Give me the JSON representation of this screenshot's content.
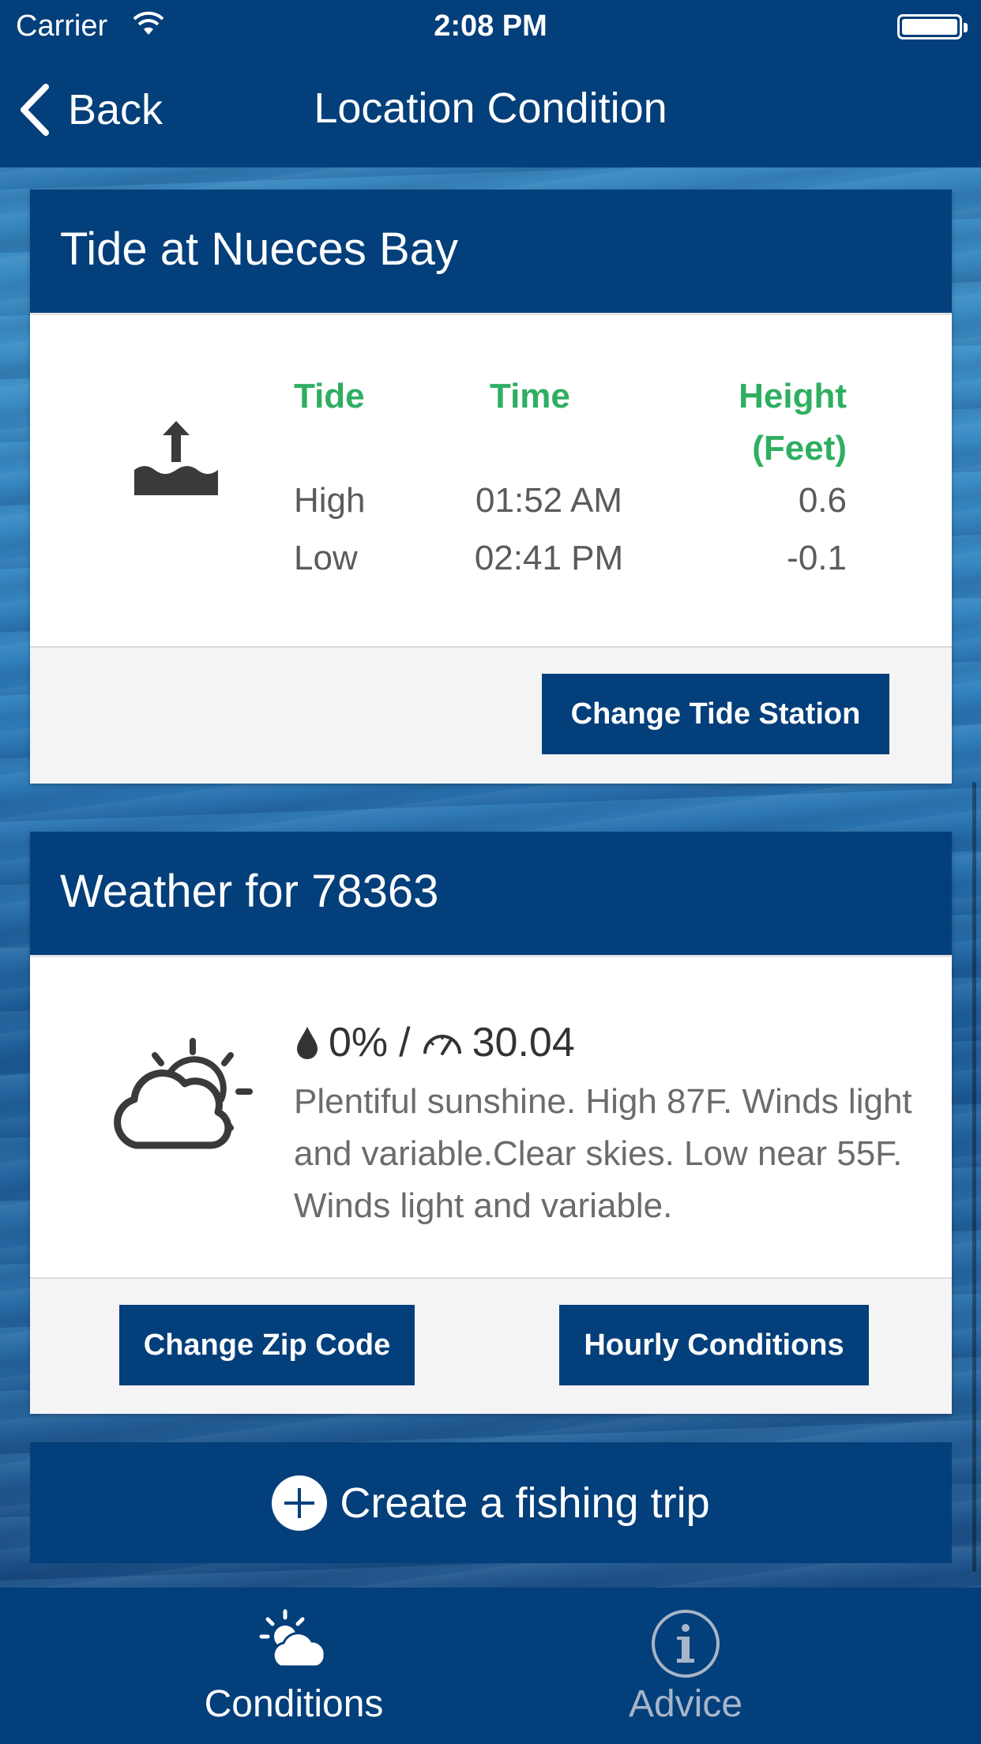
{
  "status_bar": {
    "carrier": "Carrier",
    "time": "2:08 PM"
  },
  "nav": {
    "back_label": "Back",
    "title": "Location Condition"
  },
  "tide": {
    "header": "Tide at Nueces Bay",
    "columns": {
      "tide": "Tide",
      "time": "Time",
      "height_line1": "Height",
      "height_line2": "(Feet)"
    },
    "rows": [
      {
        "tide": "High",
        "time": "01:52 AM",
        "height": "0.6"
      },
      {
        "tide": "Low",
        "time": "02:41 PM",
        "height": "-0.1"
      }
    ],
    "button": "Change Tide Station",
    "icon": "tide-rising-icon"
  },
  "weather": {
    "header": "Weather for 78363",
    "precipitation": "0%",
    "separator": "/",
    "pressure": "30.04",
    "description": "Plentiful sunshine. High 87F. Winds light and variable.Clear skies. Low near 55F. Winds light and variable.",
    "buttons": {
      "zip": "Change Zip Code",
      "hourly": "Hourly Conditions"
    },
    "icon": "partly-sunny-icon"
  },
  "create_trip": {
    "label": "Create a fishing trip"
  },
  "tabs": [
    {
      "label": "Conditions",
      "icon": "sun-cloud-icon",
      "active": true
    },
    {
      "label": "Advice",
      "icon": "info-circle-icon",
      "active": false
    }
  ],
  "colors": {
    "primary": "#033f7a",
    "table_header": "#2fae62",
    "text_muted": "#5b5b5b",
    "inactive_tab": "#a7b5c9"
  }
}
